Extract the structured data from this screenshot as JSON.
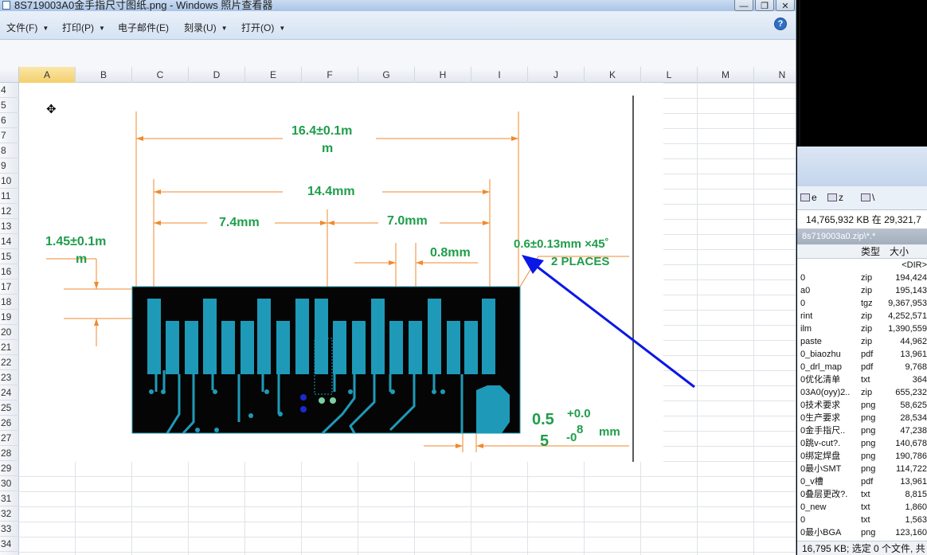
{
  "window": {
    "title": "8S719003A0金手指尺寸图纸.png - Windows 照片查看器",
    "controls": [
      "—",
      "❐",
      "✕"
    ]
  },
  "menubar": {
    "items": [
      {
        "label": "文件(F)"
      },
      {
        "label": "打印(P)"
      },
      {
        "label": "电子邮件(E)"
      },
      {
        "label": "刻录(U)"
      },
      {
        "label": "打开(O)"
      }
    ],
    "help_label": "?"
  },
  "spreadsheet": {
    "columns": [
      "A",
      "B",
      "C",
      "D",
      "E",
      "F",
      "G",
      "H",
      "I",
      "J",
      "K",
      "L",
      "M",
      "N"
    ],
    "selected_column": "A",
    "rows": [
      "4",
      "5",
      "6",
      "7",
      "8",
      "9",
      "10",
      "11",
      "12",
      "13",
      "14",
      "15",
      "16",
      "17",
      "18",
      "19",
      "20",
      "21",
      "22",
      "23",
      "24",
      "25",
      "26",
      "27",
      "28",
      "29",
      "30",
      "31",
      "32",
      "33",
      "34"
    ]
  },
  "drawing": {
    "dim_overall_a": "16.4±0.1m",
    "dim_overall_b": "m",
    "dim_fingers": "14.4mm",
    "dim_left": "7.4mm",
    "dim_right": "7.0mm",
    "dim_pitch": "0.8mm",
    "dim_height_a": "1.45±0.1m",
    "dim_height_b": "m",
    "dim_chamfer": "0.6±0.13mm ×45˚",
    "dim_places": "2 PLACES",
    "dim_thick_a": "0.5",
    "dim_thick_b": "5",
    "dim_tol_plus": "+0.0",
    "dim_tol_8": "8",
    "dim_tol_minus": "-0",
    "dim_tol_unit": "mm",
    "colors": {
      "dimension_line": "#f08a2c",
      "dimension_text": "#1f9d4b",
      "pcb": "#050505",
      "copper": "#1e9ab8",
      "annotation_arrow": "#0a17e6"
    }
  },
  "file_panel": {
    "toolbar": [
      {
        "icon": "drive-icon",
        "label": "e"
      },
      {
        "icon": "network-icon",
        "label": "z"
      },
      {
        "icon": "tree-icon",
        "label": "\\"
      }
    ],
    "disk_info": "14,765,932 KB 在 29,321,7",
    "path": "8s719003a0.zip\\*.*",
    "headers": {
      "type": "类型",
      "size": "大小"
    },
    "rows": [
      {
        "name": "",
        "type": "",
        "size": "<DIR>"
      },
      {
        "name": "0",
        "type": "zip",
        "size": "194,424"
      },
      {
        "name": "a0",
        "type": "zip",
        "size": "195,143"
      },
      {
        "name": "0",
        "type": "tgz",
        "size": "9,367,953"
      },
      {
        "name": "rint",
        "type": "zip",
        "size": "4,252,571"
      },
      {
        "name": "ilm",
        "type": "zip",
        "size": "1,390,559"
      },
      {
        "name": "paste",
        "type": "zip",
        "size": "44,962"
      },
      {
        "name": "0_biaozhu",
        "type": "pdf",
        "size": "13,961"
      },
      {
        "name": "0_drl_map",
        "type": "pdf",
        "size": "9,768"
      },
      {
        "name": "0优化清单",
        "type": "txt",
        "size": "364"
      },
      {
        "name": "03A0(oyy)2..",
        "type": "zip",
        "size": "655,232"
      },
      {
        "name": "0技术要求",
        "type": "png",
        "size": "58,625"
      },
      {
        "name": "0生产要求",
        "type": "png",
        "size": "28,534"
      },
      {
        "name": "0金手指尺..",
        "type": "png",
        "size": "47,238"
      },
      {
        "name": "0跳v-cut?.",
        "type": "png",
        "size": "140,678"
      },
      {
        "name": "0绑定焊盘",
        "type": "png",
        "size": "190,786"
      },
      {
        "name": "0最小SMT",
        "type": "png",
        "size": "114,722"
      },
      {
        "name": "0_v槽",
        "type": "pdf",
        "size": "13,961"
      },
      {
        "name": "0叠层更改?.",
        "type": "txt",
        "size": "8,815"
      },
      {
        "name": "0_new",
        "type": "txt",
        "size": "1,860"
      },
      {
        "name": "0",
        "type": "txt",
        "size": "1,563"
      },
      {
        "name": "0最小BGA",
        "type": "png",
        "size": "123,160"
      }
    ],
    "status": "16,795 KB; 选定 0 个文件, 共"
  }
}
